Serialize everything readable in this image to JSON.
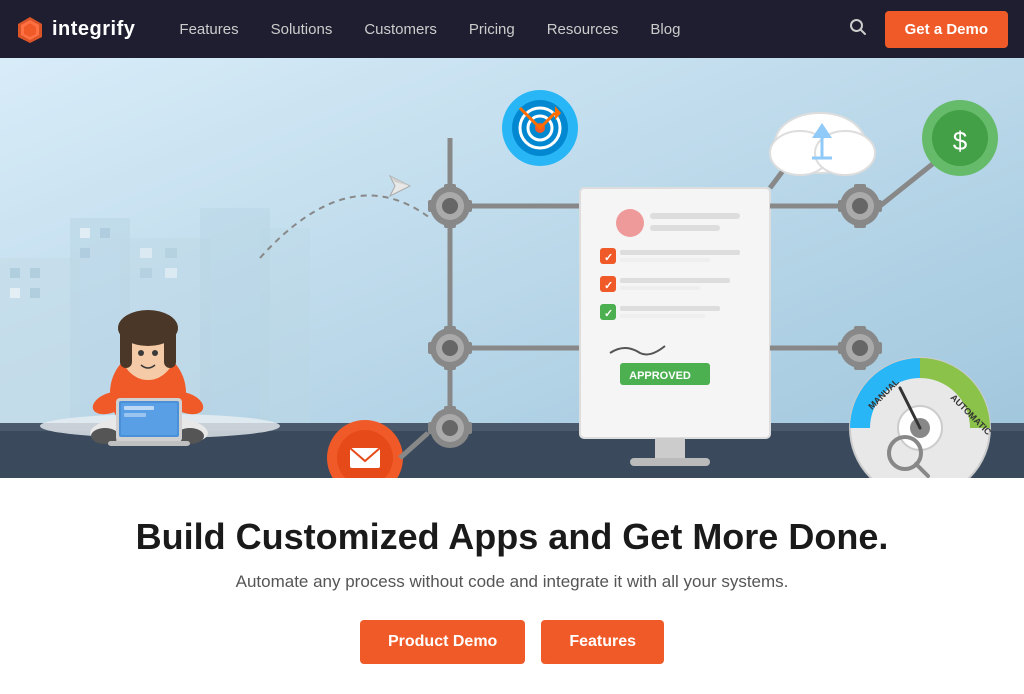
{
  "nav": {
    "logo_text": "integrify",
    "links": [
      {
        "label": "Features",
        "id": "features"
      },
      {
        "label": "Solutions",
        "id": "solutions"
      },
      {
        "label": "Customers",
        "id": "customers"
      },
      {
        "label": "Pricing",
        "id": "pricing"
      },
      {
        "label": "Resources",
        "id": "resources"
      },
      {
        "label": "Blog",
        "id": "blog"
      }
    ],
    "demo_button": "Get a Demo"
  },
  "hero": {
    "alt": "Workflow automation illustration"
  },
  "content": {
    "headline": "Build Customized Apps and Get More Done.",
    "subheadline": "Automate any process without code and integrate it with all your systems.",
    "cta_primary": "Product Demo",
    "cta_secondary": "Features"
  },
  "colors": {
    "nav_bg": "#1e1e30",
    "orange": "#f05a28",
    "hero_bg_start": "#d0e8f5",
    "hero_bg_end": "#8bb5d4"
  }
}
